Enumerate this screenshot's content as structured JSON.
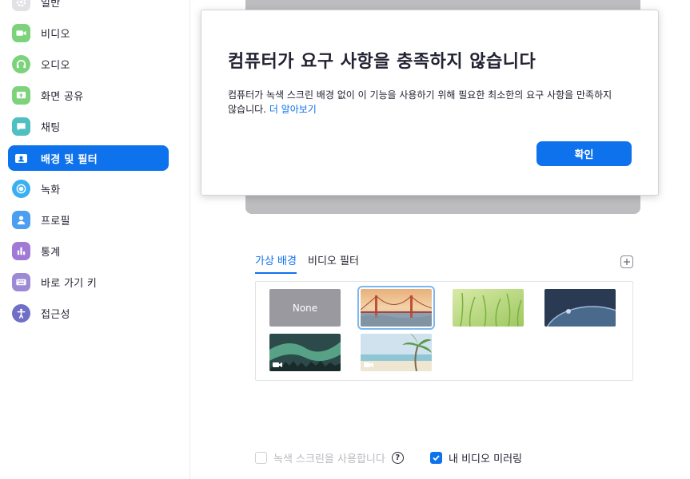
{
  "sidebar": {
    "items": [
      {
        "label": "일반",
        "icon": "gear-icon",
        "color": "#d6d6da"
      },
      {
        "label": "비디오",
        "icon": "video-camera-icon",
        "color": "#7cd37c"
      },
      {
        "label": "오디오",
        "icon": "headphones-icon",
        "color": "#7cd37c"
      },
      {
        "label": "화면 공유",
        "icon": "share-screen-icon",
        "color": "#7cd37c"
      },
      {
        "label": "채팅",
        "icon": "chat-bubble-icon",
        "color": "#4fbfbf"
      },
      {
        "label": "배경 및 필터",
        "icon": "contact-card-icon",
        "color": "#ffffff",
        "active": true
      },
      {
        "label": "녹화",
        "icon": "record-icon",
        "color": "#3ab0f0"
      },
      {
        "label": "프로필",
        "icon": "profile-icon",
        "color": "#4c9ef0"
      },
      {
        "label": "통계",
        "icon": "bar-chart-icon",
        "color": "#a07ad6"
      },
      {
        "label": "바로 가기 키",
        "icon": "keyboard-icon",
        "color": "#9d8ad6"
      },
      {
        "label": "접근성",
        "icon": "accessibility-icon",
        "color": "#6f6fc8"
      }
    ]
  },
  "tabs": [
    {
      "label": "가상 배경",
      "active": true
    },
    {
      "label": "비디오 필터",
      "active": false
    }
  ],
  "backgrounds": {
    "none_label": "None",
    "items": [
      {
        "name": "none"
      },
      {
        "name": "golden-gate-bridge",
        "selected": true
      },
      {
        "name": "grass"
      },
      {
        "name": "earth-from-space"
      },
      {
        "name": "aurora",
        "video": true
      },
      {
        "name": "beach-palm",
        "video": true
      }
    ]
  },
  "options": {
    "green_screen_label": "녹색 스크린을 사용합니다",
    "green_screen_checked": false,
    "mirror_label": "내 비디오 미러링",
    "mirror_checked": true,
    "help_glyph": "?"
  },
  "dialog": {
    "title": "컴퓨터가 요구 사항을 충족하지 않습니다",
    "body": "컴퓨터가 녹색 스크린 배경 없이 이 기능을 사용하기 위해 필요한 최소한의 요구 사항을 만족하지 않습니다.",
    "link": "더 알아보기",
    "ok_label": "확인"
  },
  "colors": {
    "accent": "#0e72ed"
  }
}
